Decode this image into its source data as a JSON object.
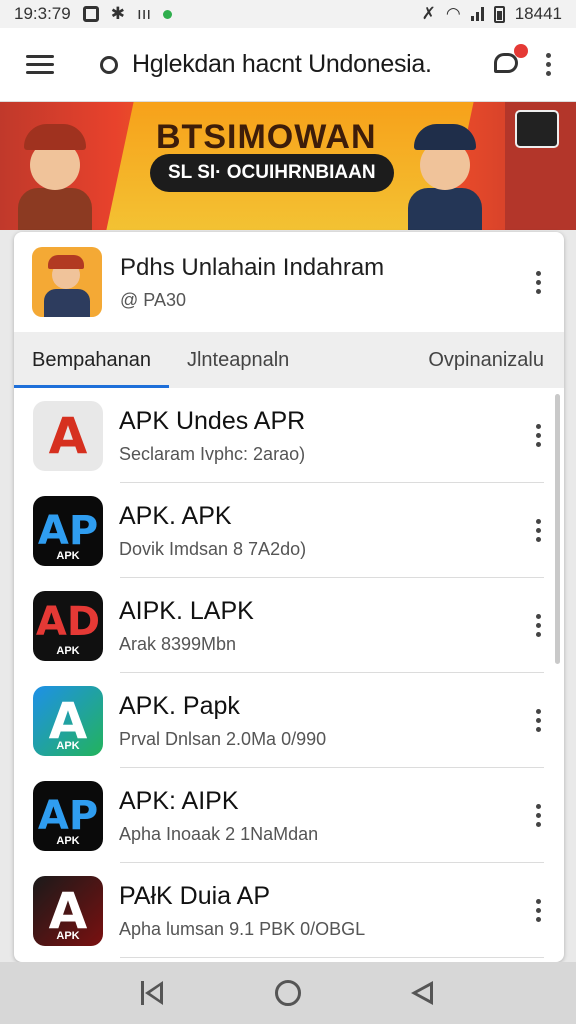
{
  "status_bar": {
    "time": "19:3:79",
    "battery_text": "18441"
  },
  "app_bar": {
    "title": "Hglekdan hacnt Undonesia."
  },
  "banner": {
    "title": "BTSIMOWAN",
    "subtitle": "SL SI· OCUIHRNBIAAN"
  },
  "header_card": {
    "title": "Pdhs Unlahain Indahram",
    "subtitle": "@ PA30"
  },
  "tabs": [
    {
      "label": "Bempahanan"
    },
    {
      "label": "Jlnteapnaln"
    },
    {
      "label": "Ovpinanizalu"
    }
  ],
  "apps": [
    {
      "name": "APK Undes APR",
      "meta": "Seclaram Ivphc: 2arao)",
      "icon_glyph": "A",
      "icon_tag": ""
    },
    {
      "name": "APK. APK",
      "meta": "Dovik Imdsan 8 7A2do)",
      "icon_glyph": "AP",
      "icon_tag": "APK"
    },
    {
      "name": "AIPK. LAPK",
      "meta": "Arak 8399Mbn",
      "icon_glyph": "AD",
      "icon_tag": "APK"
    },
    {
      "name": "APK. Papk",
      "meta": "Prval Dnlsan 2.0Ma 0/990",
      "icon_glyph": "A",
      "icon_tag": "APK"
    },
    {
      "name": "APK: AIPK",
      "meta": "Apha Inoaak 2 1NaMdan",
      "icon_glyph": "AP",
      "icon_tag": "APK"
    },
    {
      "name": "PAłK Duia AP",
      "meta": "Apha lumsan 9.1 PBK 0/OBGL",
      "icon_glyph": "A",
      "icon_tag": "APK"
    }
  ],
  "colors": {
    "accent": "#1e6fd9",
    "icon_colors": [
      "#e8e8e8",
      "#0a0a0a",
      "#101010",
      "#1e90e8",
      "#0a0a0a",
      "#0e0e0e"
    ]
  }
}
